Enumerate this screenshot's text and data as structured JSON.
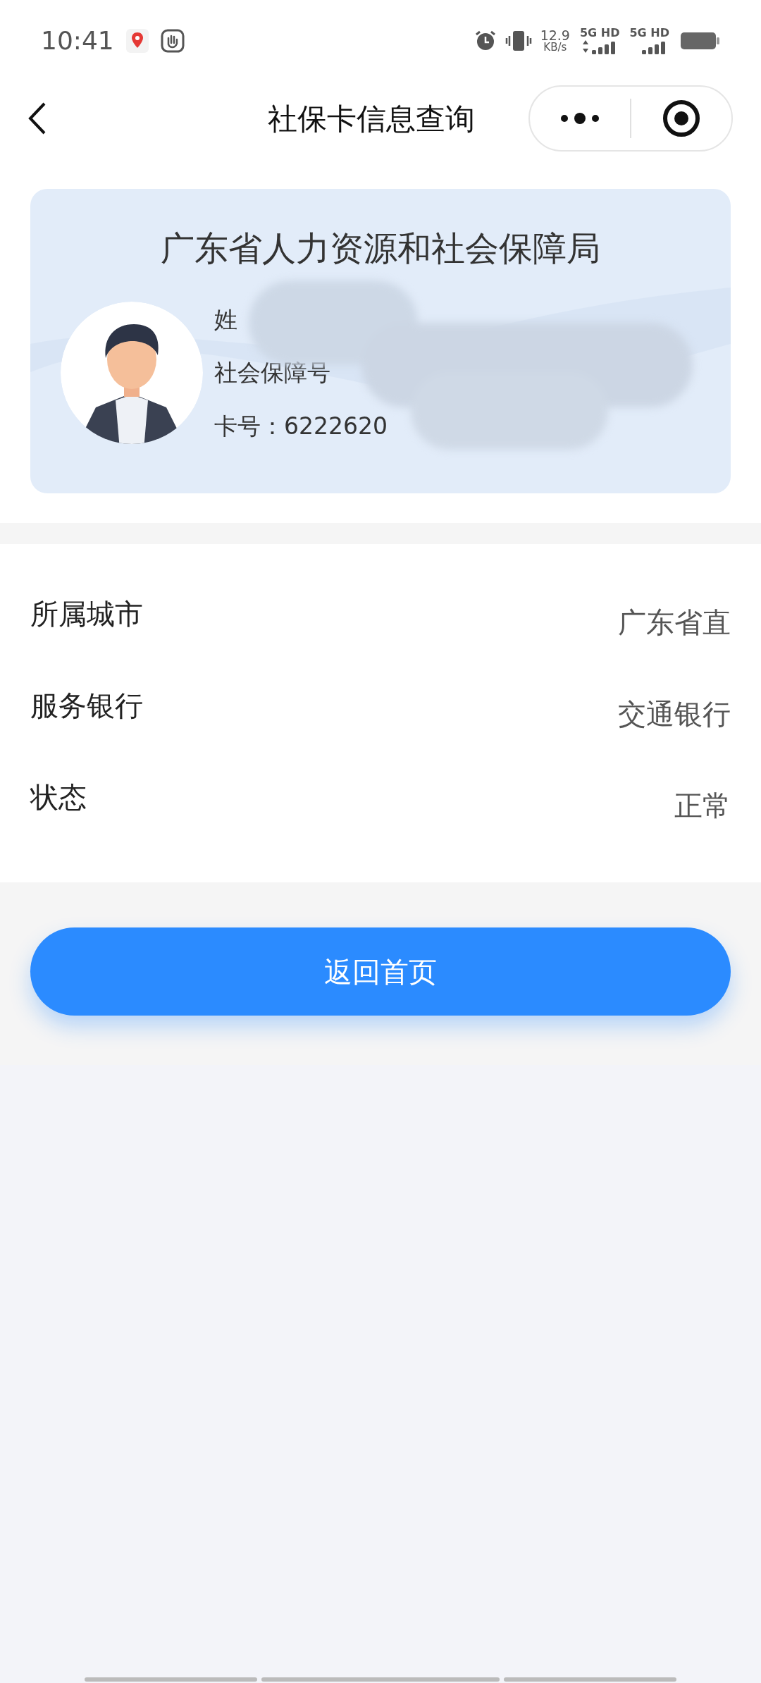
{
  "status_bar": {
    "time": "10:41",
    "speed_value": "12.9",
    "speed_unit": "KB/s",
    "networks": [
      {
        "label": "5G HD",
        "arrows": true
      },
      {
        "label": "5G HD",
        "arrows": false
      }
    ]
  },
  "nav": {
    "title": "社保卡信息查询"
  },
  "card": {
    "issuer": "广东省人力资源和社会保障局",
    "lines": [
      "姓",
      "社会保障号",
      "卡号：6222620"
    ]
  },
  "details": [
    {
      "label": "所属城市",
      "value": "广东省直"
    },
    {
      "label": "服务银行",
      "value": "交通银行"
    },
    {
      "label": "状态",
      "value": "正常"
    }
  ],
  "home_button": {
    "label": "返回首页"
  }
}
